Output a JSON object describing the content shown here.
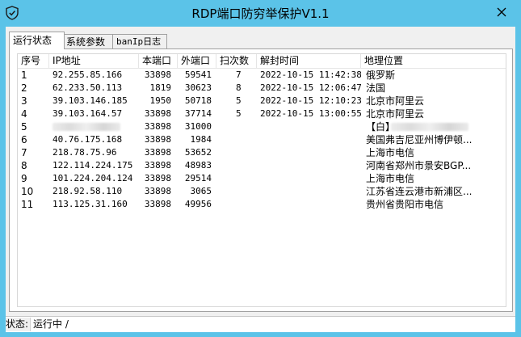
{
  "window": {
    "title": "RDP端口防穷举保护V1.1"
  },
  "tabs": [
    "运行状态",
    "系统参数",
    "banIp日志"
  ],
  "table": {
    "columns": [
      "序号",
      "IP地址",
      "本端口",
      "外端口",
      "扫次数",
      "解封时间",
      "地理位置"
    ],
    "rows": [
      [
        "1",
        "92.255.85.166",
        "33898",
        "59541",
        "7",
        "2022-10-15 11:42:38",
        "俄罗斯"
      ],
      [
        "2",
        "62.233.50.113",
        "1819",
        "30623",
        "8",
        "2022-10-15 12:06:47",
        "法国"
      ],
      [
        "3",
        "39.103.146.185",
        "1950",
        "50718",
        "5",
        "2022-10-15 12:10:23",
        "北京市阿里云"
      ],
      [
        "4",
        "39.103.164.57",
        "33898",
        "37714",
        "5",
        "2022-10-15 13:00:55",
        "北京市阿里云"
      ],
      [
        "5",
        "",
        "33898",
        "31000",
        "",
        "",
        "【白】"
      ],
      [
        "6",
        "40.76.175.168",
        "33898",
        "1984",
        "",
        "",
        "美国弗吉尼亚州博伊顿..."
      ],
      [
        "7",
        "218.78.75.96",
        "33898",
        "53652",
        "",
        "",
        "上海市电信"
      ],
      [
        "8",
        "122.114.224.175",
        "33898",
        "48983",
        "",
        "",
        "河南省郑州市景安BGP..."
      ],
      [
        "9",
        "101.224.204.124",
        "33898",
        "29514",
        "",
        "",
        "上海市电信"
      ],
      [
        "10",
        "218.92.58.110",
        "33898",
        "3065",
        "",
        "",
        "江苏省连云港市新浦区..."
      ],
      [
        "11",
        "113.125.31.160",
        "33898",
        "49956",
        "",
        "",
        "贵州省贵阳市电信"
      ]
    ]
  },
  "status": {
    "label": "状态:",
    "value": "运行中 /"
  }
}
